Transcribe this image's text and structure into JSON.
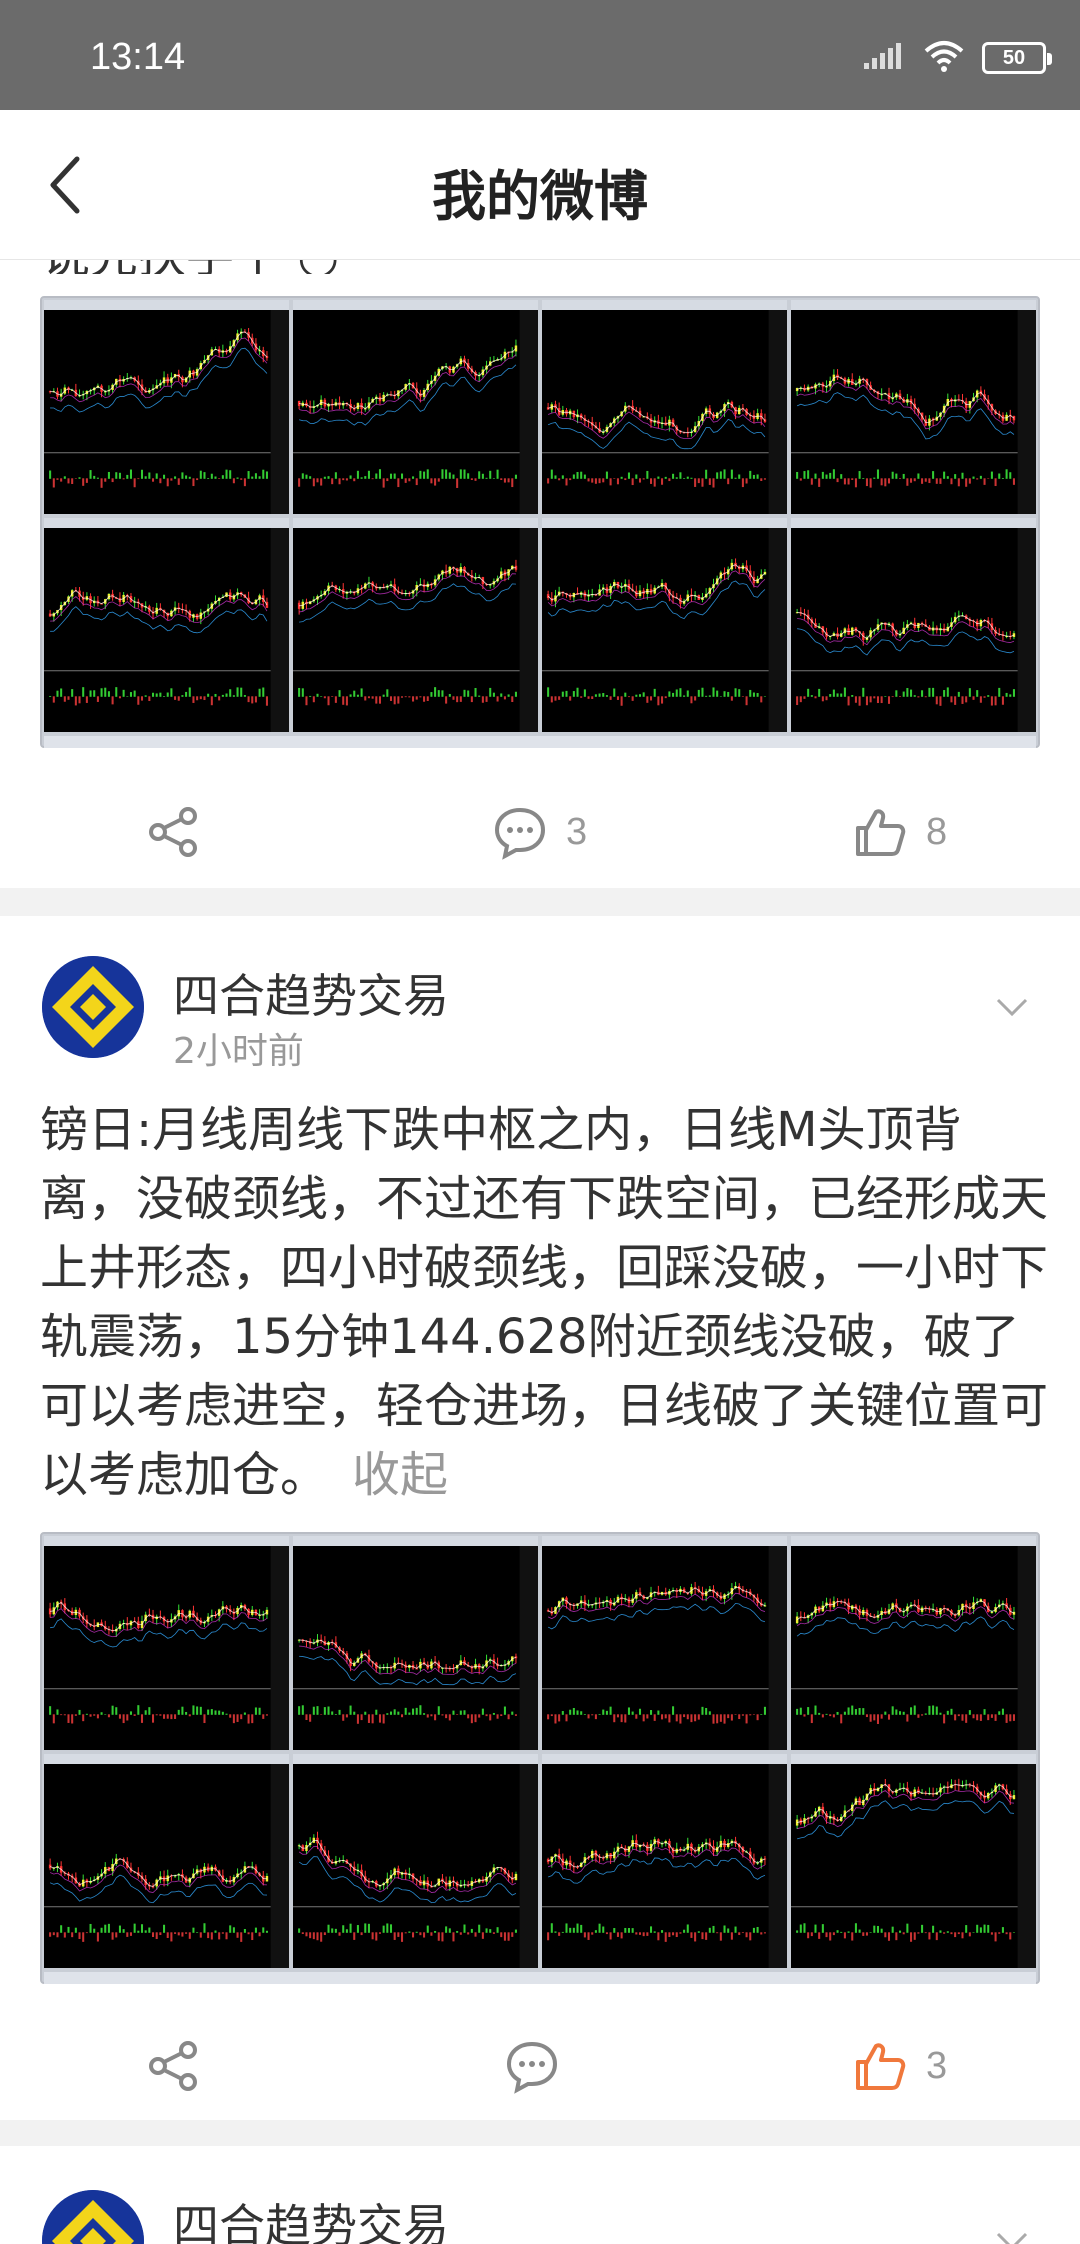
{
  "status_bar": {
    "time": "13:14",
    "battery": "50"
  },
  "header": {
    "title": "我的微博"
  },
  "posts": [
    {
      "clipped_text": "说先扶手平 ◡",
      "actions": {
        "comments": "3",
        "likes": "8",
        "liked": false
      }
    },
    {
      "author": "四合趋势交易",
      "time": "2小时前",
      "text": "镑日:月线周线下跌中枢之内，日线M头顶背离，没破颈线，不过还有下跌空间，已经形成天上井形态，四小时破颈线，回踩没破，一小时下轨震荡，15分钟144.628附近颈线没破，破了可以考虑进空，轻仓进场，日线破了关键位置可以考虑加仓。",
      "collapse_label": "收起",
      "actions": {
        "comments": "",
        "likes": "3",
        "liked": true
      }
    },
    {
      "author": "四合趋势交易"
    }
  ],
  "colors": {
    "accent": "#f0783c",
    "muted": "#999999",
    "status_bar": "#6b6b6b"
  },
  "icons": {
    "back": "chevron-left-icon",
    "share": "share-icon",
    "comment": "comment-icon",
    "like": "thumb-up-icon",
    "more": "chevron-down-icon"
  }
}
